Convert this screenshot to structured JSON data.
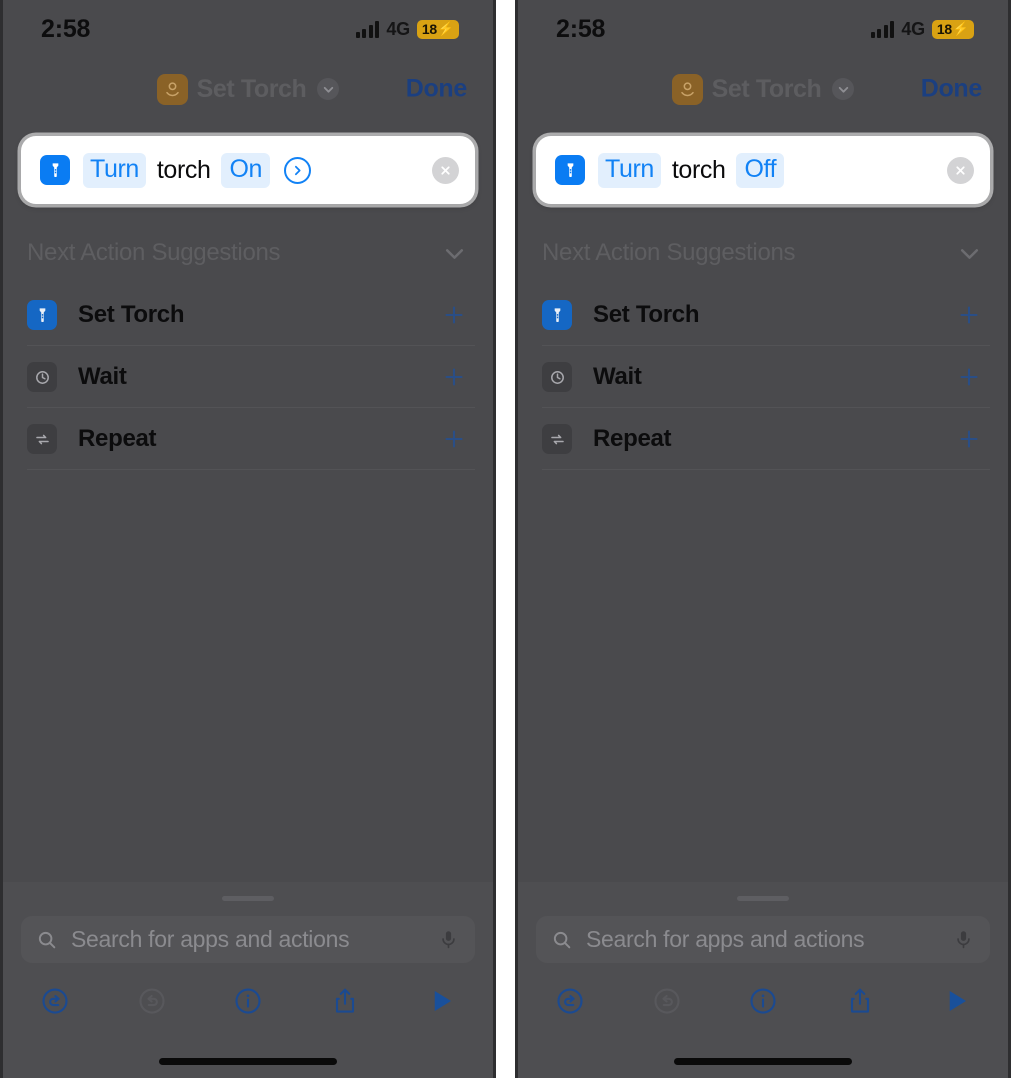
{
  "panels": [
    {
      "id": "left",
      "status": {
        "time": "2:58",
        "network": "4G",
        "battery_percent": "18",
        "battery_charging_glyph": "⚡",
        "signal_icon": "signal-bars-icon"
      },
      "nav": {
        "app_icon": "shortcuts-icon",
        "title": "Set Torch",
        "chevron_icon": "chevron-down-icon",
        "done_label": "Done"
      },
      "action_card": {
        "icon": "flashlight-icon",
        "verb": "Turn",
        "object": "torch",
        "value": "On",
        "has_disclosure": true,
        "disclosure_icon": "chevron-right-circle-icon",
        "clear_icon": "clear-circle-icon"
      },
      "suggestions": {
        "title": "Next Action Suggestions",
        "collapse_icon": "chevron-down-icon",
        "items": [
          {
            "label": "Set Torch",
            "icon": "flashlight-icon",
            "icon_color": "blue",
            "add_icon": "plus-icon"
          },
          {
            "label": "Wait",
            "icon": "clock-icon",
            "icon_color": "gray",
            "add_icon": "plus-icon"
          },
          {
            "label": "Repeat",
            "icon": "repeat-icon",
            "icon_color": "gray",
            "add_icon": "plus-icon"
          }
        ]
      },
      "sheet": {
        "search_placeholder": "Search for apps and actions",
        "search_value": "",
        "search_icon": "search-icon",
        "mic_icon": "microphone-icon",
        "toolbar": [
          {
            "name": "undo-button",
            "icon": "undo-icon",
            "enabled": true
          },
          {
            "name": "redo-button",
            "icon": "redo-icon",
            "enabled": false
          },
          {
            "name": "info-button",
            "icon": "info-circle-icon",
            "enabled": true
          },
          {
            "name": "share-button",
            "icon": "share-icon",
            "enabled": true
          },
          {
            "name": "run-button",
            "icon": "play-icon",
            "enabled": true
          }
        ]
      }
    },
    {
      "id": "right",
      "status": {
        "time": "2:58",
        "network": "4G",
        "battery_percent": "18",
        "battery_charging_glyph": "⚡",
        "signal_icon": "signal-bars-icon"
      },
      "nav": {
        "app_icon": "shortcuts-icon",
        "title": "Set Torch",
        "chevron_icon": "chevron-down-icon",
        "done_label": "Done"
      },
      "action_card": {
        "icon": "flashlight-icon",
        "verb": "Turn",
        "object": "torch",
        "value": "Off",
        "has_disclosure": false,
        "disclosure_icon": "",
        "clear_icon": "clear-circle-icon"
      },
      "suggestions": {
        "title": "Next Action Suggestions",
        "collapse_icon": "chevron-down-icon",
        "items": [
          {
            "label": "Set Torch",
            "icon": "flashlight-icon",
            "icon_color": "blue",
            "add_icon": "plus-icon"
          },
          {
            "label": "Wait",
            "icon": "clock-icon",
            "icon_color": "gray",
            "add_icon": "plus-icon"
          },
          {
            "label": "Repeat",
            "icon": "repeat-icon",
            "icon_color": "gray",
            "add_icon": "plus-icon"
          }
        ]
      },
      "sheet": {
        "search_placeholder": "Search for apps and actions",
        "search_value": "",
        "search_icon": "search-icon",
        "mic_icon": "microphone-icon",
        "toolbar": [
          {
            "name": "undo-button",
            "icon": "undo-icon",
            "enabled": true
          },
          {
            "name": "redo-button",
            "icon": "redo-icon",
            "enabled": false
          },
          {
            "name": "info-button",
            "icon": "info-circle-icon",
            "enabled": true
          },
          {
            "name": "share-button",
            "icon": "share-icon",
            "enabled": true
          },
          {
            "name": "run-button",
            "icon": "play-icon",
            "enabled": true
          }
        ]
      }
    }
  ],
  "colors": {
    "accent_blue": "#1282f5",
    "chip_blue": "#0a7cf3",
    "token_pill_bg": "#e2effd",
    "battery_yellow": "#d9a213",
    "panel_bg": "#4a4a4d",
    "card_white": "#ffffff"
  }
}
